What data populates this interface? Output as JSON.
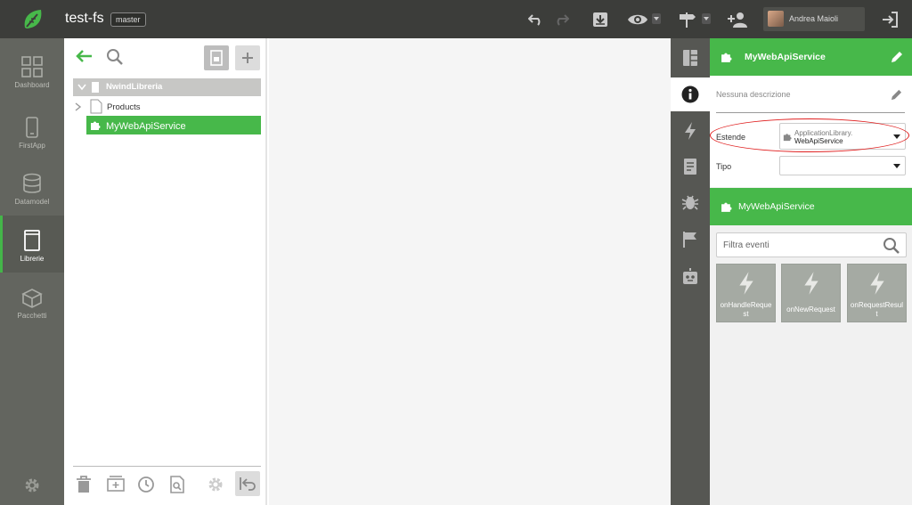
{
  "app": {
    "title": "test-fs",
    "branch": "master",
    "user_name": "Andrea Maioli"
  },
  "toolbar_icons": [
    "undo-icon",
    "redo-icon",
    "download-icon",
    "eye-icon",
    "signpost-icon",
    "add-user-icon",
    "logout-icon"
  ],
  "leftnav": {
    "items": [
      {
        "label": "Dashboard",
        "icon": "grid-icon"
      },
      {
        "label": "FirstApp",
        "icon": "phone-icon"
      },
      {
        "label": "Datamodel",
        "icon": "database-icon"
      },
      {
        "label": "Librerie",
        "icon": "book-icon",
        "active": true
      },
      {
        "label": "Pacchetti",
        "icon": "box-icon"
      }
    ]
  },
  "tree": {
    "root": "NwindLibreria",
    "items": [
      "Products",
      "MyWebApiService"
    ],
    "selected": "MyWebApiService"
  },
  "rightpanel": {
    "header_title": "MyWebApiService",
    "description_placeholder": "Nessuna descrizione",
    "extends_label": "Estende",
    "extends_value_line1": "ApplicationLibrary.",
    "extends_value_line2": "WebApiService",
    "type_label": "Tipo",
    "type_value": "",
    "events_header": "MyWebApiService",
    "search_placeholder": "Filtra eventi",
    "events": [
      "onHandleRequest",
      "onNewRequest",
      "onRequestResult"
    ]
  },
  "colors": {
    "accent": "#47b84a",
    "topbar": "#3c3d3a",
    "leftnav": "#63655f",
    "highlight": "#e02020"
  }
}
